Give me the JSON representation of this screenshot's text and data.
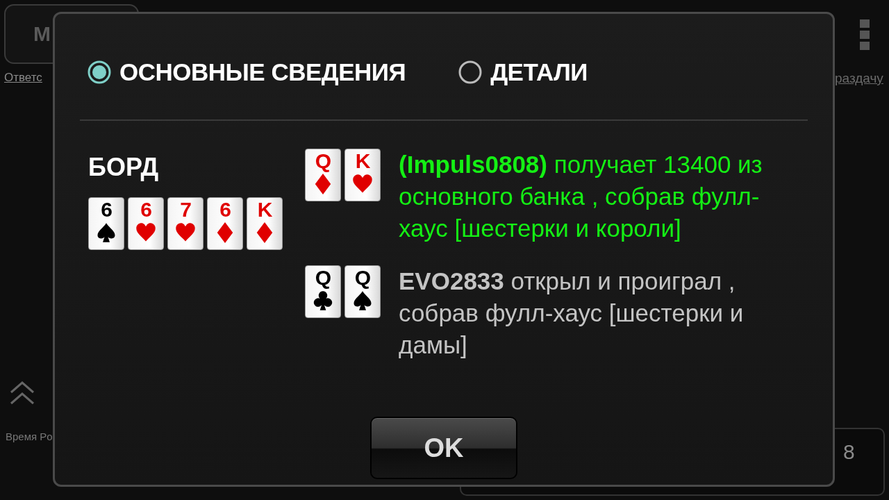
{
  "top_bar": {
    "menu_button": "М"
  },
  "links": {
    "left": "Ответс",
    "right": "раздачу"
  },
  "clock": "Время Po",
  "chat": {
    "text": "8"
  },
  "dialog": {
    "tabs": [
      {
        "label": "ОСНОВНЫЕ СВЕДЕНИЯ",
        "selected": true
      },
      {
        "label": "ДЕТАЛИ",
        "selected": false
      }
    ],
    "board": {
      "title": "БОРД",
      "cards": [
        {
          "rank": "6",
          "kind": "spades"
        },
        {
          "rank": "6",
          "kind": "hearts"
        },
        {
          "rank": "7",
          "kind": "hearts"
        },
        {
          "rank": "6",
          "kind": "diamonds"
        },
        {
          "rank": "K",
          "kind": "diamonds"
        }
      ]
    },
    "results": [
      {
        "kind": "winner",
        "cards": [
          {
            "rank": "Q",
            "kind": "diamonds"
          },
          {
            "rank": "K",
            "kind": "hearts"
          }
        ],
        "text": "**(Impuls0808)** получает 13400 из основного банка , собрав фулл-хаус [шестерки и короли]"
      },
      {
        "kind": "loser",
        "cards": [
          {
            "rank": "Q",
            "kind": "clubs"
          },
          {
            "rank": "Q",
            "kind": "spades"
          }
        ],
        "text": "**EVO2833** открыл и проиграл , собрав фулл-хаус [шестерки и дамы]"
      }
    ],
    "ok_button": "OK"
  }
}
